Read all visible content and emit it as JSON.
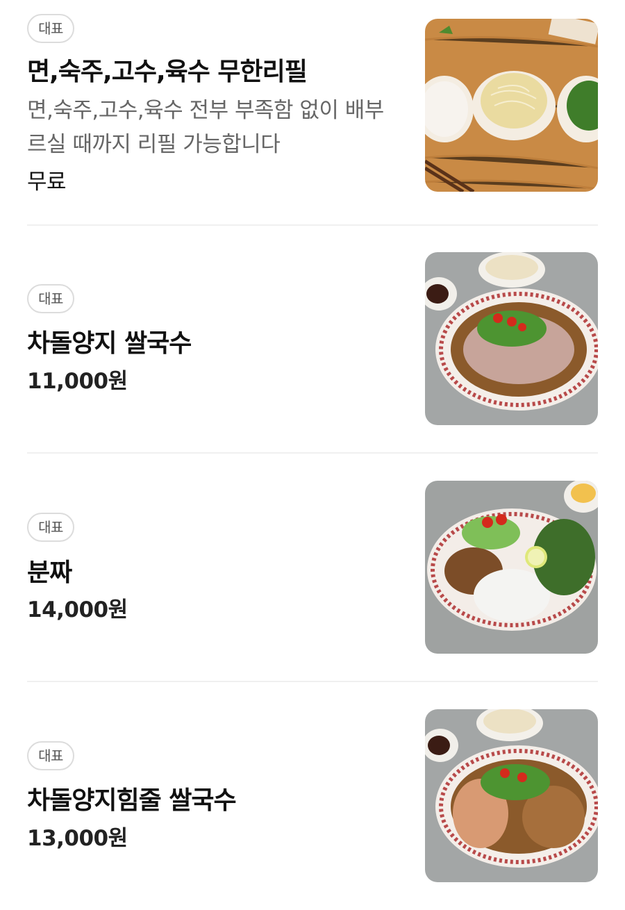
{
  "menu": {
    "items": [
      {
        "badge": "대표",
        "name": "면,숙주,고수,육수 무한리필",
        "description": "면,숙주,고수,육수 전부 부족함 없이 배부르실 때까지 리필 가능합니다",
        "price": "무료",
        "image": "noodle-sprout-cilantro-bowls-photo"
      },
      {
        "badge": "대표",
        "name": "차돌양지 쌀국수",
        "price": "11,000원",
        "image": "brisket-pho-photo"
      },
      {
        "badge": "대표",
        "name": "분짜",
        "price": "14,000원",
        "image": "bun-cha-photo"
      },
      {
        "badge": "대표",
        "name": "차돌양지힘줄 쌀국수",
        "price": "13,000원",
        "image": "brisket-tendon-pho-photo"
      }
    ]
  },
  "colors": {
    "badge_border": "#dcdcdc",
    "description_text": "#666666",
    "divider": "#f0f0f0"
  }
}
